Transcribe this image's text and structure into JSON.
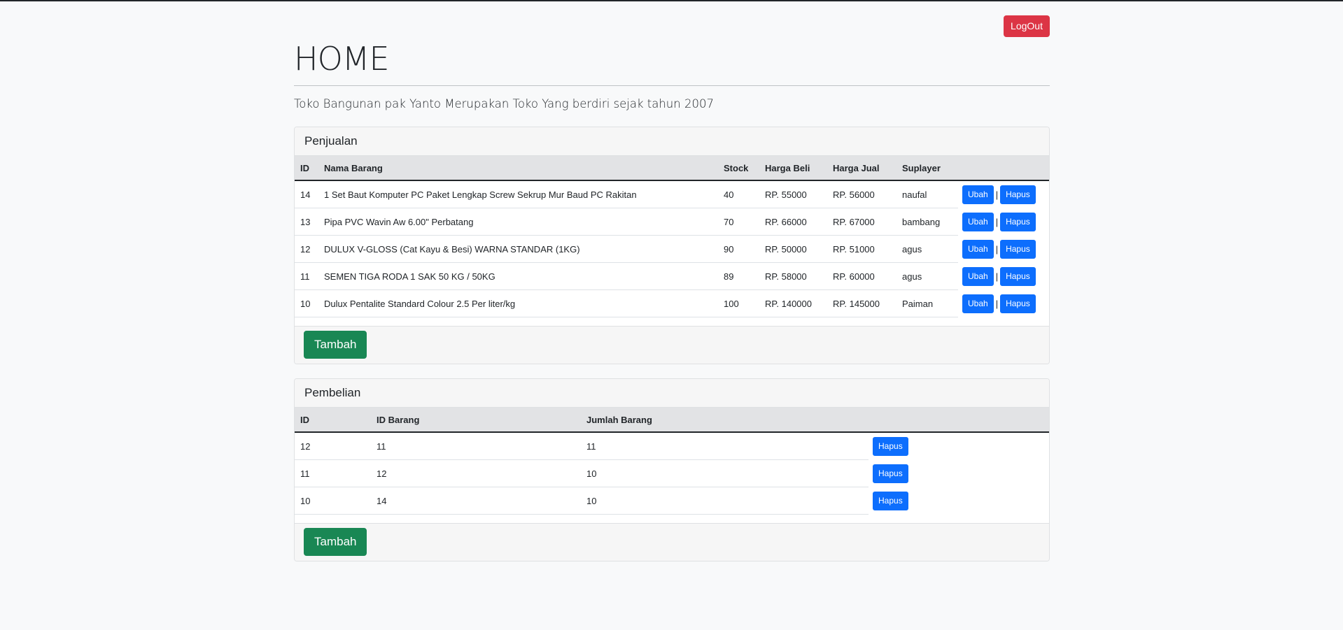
{
  "header": {
    "logout_label": "LogOut",
    "title": "HOME",
    "lead": "Toko Bangunan pak Yanto Merupakan Toko Yang berdiri sejak tahun 2007"
  },
  "penjualan": {
    "title": "Penjualan",
    "columns": [
      "ID",
      "Nama Barang",
      "Stock",
      "Harga Beli",
      "Harga Jual",
      "Suplayer",
      ""
    ],
    "edit_label": "Ubah",
    "delete_label": "Hapus",
    "separator": "|",
    "rows": [
      {
        "id": "14",
        "nama": "1 Set Baut Komputer PC Paket Lengkap Screw Sekrup Mur Baud PC Rakitan",
        "stock": "40",
        "harga_beli": "RP. 55000",
        "harga_jual": "RP. 56000",
        "suplayer": "naufal"
      },
      {
        "id": "13",
        "nama": "Pipa PVC Wavin Aw 6.00\" Perbatang",
        "stock": "70",
        "harga_beli": "RP. 66000",
        "harga_jual": "RP. 67000",
        "suplayer": "bambang"
      },
      {
        "id": "12",
        "nama": "DULUX V-GLOSS (Cat Kayu & Besi) WARNA STANDAR (1KG)",
        "stock": "90",
        "harga_beli": "RP. 50000",
        "harga_jual": "RP. 51000",
        "suplayer": "agus"
      },
      {
        "id": "11",
        "nama": "SEMEN TIGA RODA 1 SAK 50 KG / 50KG",
        "stock": "89",
        "harga_beli": "RP. 58000",
        "harga_jual": "RP. 60000",
        "suplayer": "agus"
      },
      {
        "id": "10",
        "nama": "Dulux Pentalite Standard Colour 2.5 Per liter/kg",
        "stock": "100",
        "harga_beli": "RP. 140000",
        "harga_jual": "RP. 145000",
        "suplayer": "Paiman"
      }
    ],
    "add_label": "Tambah"
  },
  "pembelian": {
    "title": "Pembelian",
    "columns": [
      "ID",
      "ID Barang",
      "Jumlah Barang",
      ""
    ],
    "delete_label": "Hapus",
    "rows": [
      {
        "id": "12",
        "id_barang": "11",
        "jumlah": "11"
      },
      {
        "id": "11",
        "id_barang": "12",
        "jumlah": "10"
      },
      {
        "id": "10",
        "id_barang": "14",
        "jumlah": "10"
      }
    ],
    "add_label": "Tambah"
  },
  "colors": {
    "danger": "#dc3545",
    "primary": "#0d6efd",
    "success": "#198754",
    "background": "#f8f9fa"
  }
}
